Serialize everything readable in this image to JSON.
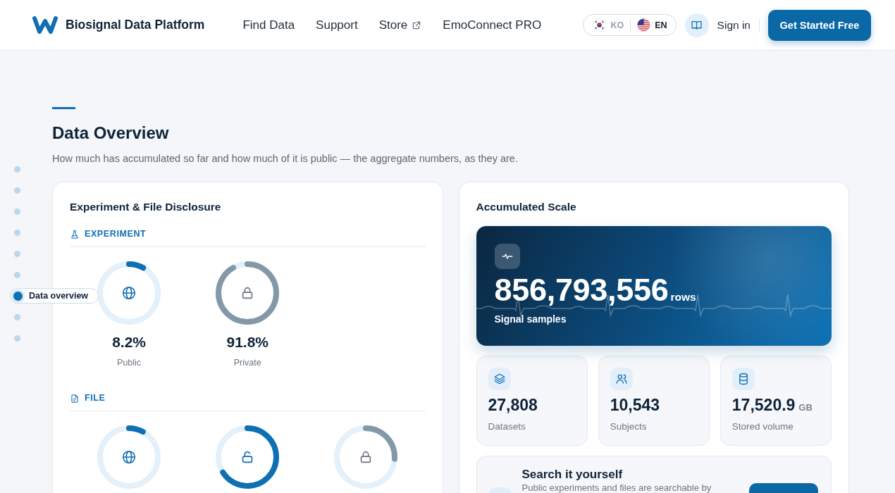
{
  "header": {
    "brand": "Biosignal Data Platform",
    "nav": [
      {
        "label": "Find Data",
        "external": false
      },
      {
        "label": "Support",
        "external": false
      },
      {
        "label": "Store",
        "external": true
      },
      {
        "label": "EmoConnect PRO",
        "external": false
      }
    ],
    "languages": [
      {
        "code": "KO",
        "kind": "kr",
        "selected": false
      },
      {
        "code": "EN",
        "kind": "us",
        "selected": true
      }
    ],
    "sign_in": "Sign in",
    "cta": "Get Started Free"
  },
  "section_nav": [
    {
      "selected": false
    },
    {
      "selected": false
    },
    {
      "selected": false
    },
    {
      "selected": false
    },
    {
      "selected": false
    },
    {
      "selected": false
    },
    {
      "label": "Data overview",
      "selected": true
    },
    {
      "selected": false
    },
    {
      "selected": false
    }
  ],
  "overview": {
    "title": "Data Overview",
    "subtitle": "How much has accumulated so far and how much of it is public — the aggregate numbers, as they are."
  },
  "disclosure": {
    "title": "Experiment & File Disclosure",
    "groups": [
      {
        "kind": "experiment",
        "label": "EXPERIMENT",
        "rings": [
          {
            "kind": "public",
            "level": 0.082,
            "value": "8.2%",
            "label": "Public"
          },
          {
            "kind": "private",
            "level": 0.918,
            "value": "91.8%",
            "label": "Private"
          }
        ]
      },
      {
        "kind": "file",
        "label": "FILE",
        "rings": [
          {
            "kind": "public",
            "level": 0.08
          },
          {
            "kind": "open",
            "level": 0.66
          },
          {
            "kind": "private",
            "level": 0.26
          }
        ]
      }
    ]
  },
  "scale": {
    "title": "Accumulated Scale",
    "hero": {
      "value": "856,793,556",
      "unit": "rows",
      "label": "Signal samples"
    },
    "stats": [
      {
        "kind": "datasets",
        "value": "27,808",
        "label": "Datasets"
      },
      {
        "kind": "subjects",
        "value": "10,543",
        "label": "Subjects"
      },
      {
        "kind": "storage",
        "value": "17,520.9",
        "unit": "GB",
        "label": "Stored volume"
      }
    ],
    "search": {
      "title": "Search it yourself",
      "text": "Public experiments and files are searchable by"
    }
  }
}
